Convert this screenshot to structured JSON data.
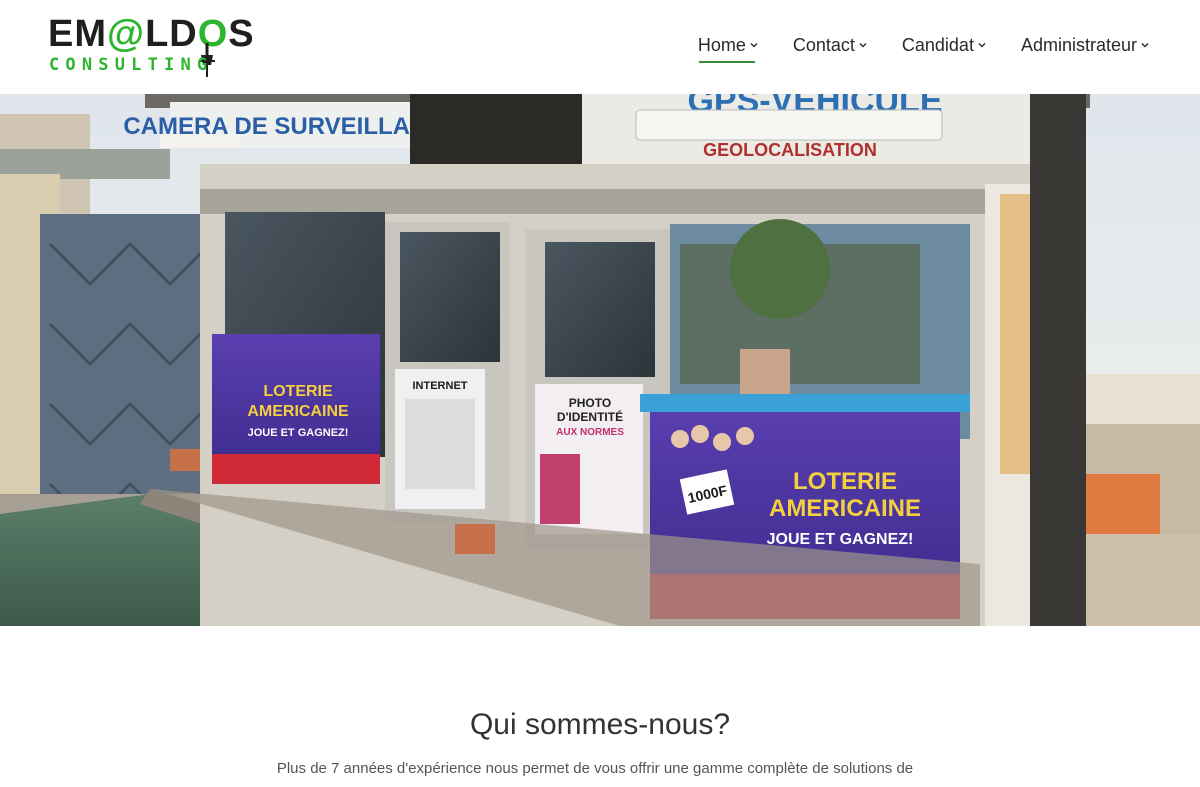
{
  "brand": {
    "logo_top_a": "EM",
    "logo_top_at": "@",
    "logo_top_b": "LD",
    "logo_top_o": "O",
    "logo_top_c": "S",
    "logo_bottom": "CONSULTING",
    "brand_green": "#2db52d"
  },
  "nav": {
    "items": [
      {
        "label": "Home",
        "active": true
      },
      {
        "label": "Contact",
        "active": false
      },
      {
        "label": "Candidat",
        "active": false
      },
      {
        "label": "Administrateur",
        "active": false
      }
    ],
    "caret_icon": "chevron-down-icon",
    "active_underline_color": "#3a8a3a"
  },
  "hero": {
    "sign_left": "CAMERA DE SURVEILLANCE",
    "sign_right": "GPS-VEHICULE",
    "sign_sub": "GEOLOCALISATION",
    "poster_title_1": "LOTERIE",
    "poster_title_2": "AMERICAINE",
    "poster_sub": "JOUE ET GAGNEZ!",
    "poster_price": "1000F",
    "poster_internet": "INTERNET",
    "poster_photo_1": "PHOTO",
    "poster_photo_2": "D'IDENTITÉ",
    "poster_photo_3": "AUX NORMES"
  },
  "about": {
    "title": "Qui sommes-nous?",
    "text": "Plus de 7 années d'expérience nous permet de vous offrir une gamme complète de solutions de"
  }
}
